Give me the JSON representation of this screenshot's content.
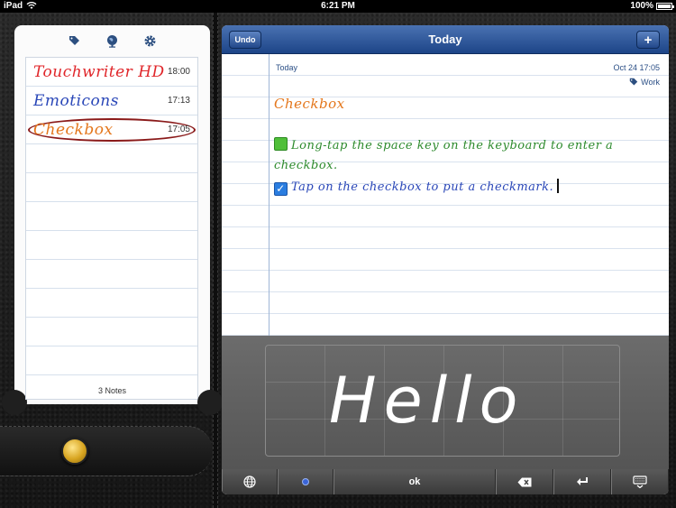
{
  "status_bar": {
    "device": "iPad",
    "time": "6:21 PM",
    "battery": "100%"
  },
  "left_panel": {
    "toolbar_icons": [
      "tag-icon",
      "globe-icon",
      "gear-icon"
    ],
    "notes": [
      {
        "title": "Touchwriter HD",
        "time": "18:00",
        "color": "#e0262a"
      },
      {
        "title": "Emoticons",
        "time": "17:13",
        "color": "#2a47b8"
      },
      {
        "title": "Checkbox",
        "time": "17:05",
        "color": "#e4761b"
      }
    ],
    "count_label": "3 Notes"
  },
  "navbar": {
    "undo_label": "Undo",
    "title": "Today",
    "add_label": "+"
  },
  "note": {
    "date_label": "Today",
    "timestamp": "Oct 24  17:05",
    "tag": "Work",
    "title": "Checkbox",
    "line1": "Long-tap the space key on the keyboard to enter a",
    "line2": "checkbox.",
    "line3": "Tap on the checkbox to put a checkmark."
  },
  "handwriting": {
    "ink": "Hello"
  },
  "keyboard": {
    "ok_label": "ok"
  },
  "colors": {
    "nav_blue": "#1d4588",
    "green_ink": "#2c8a2c",
    "blue_ink": "#2a47b8",
    "orange_ink": "#e4761b"
  }
}
